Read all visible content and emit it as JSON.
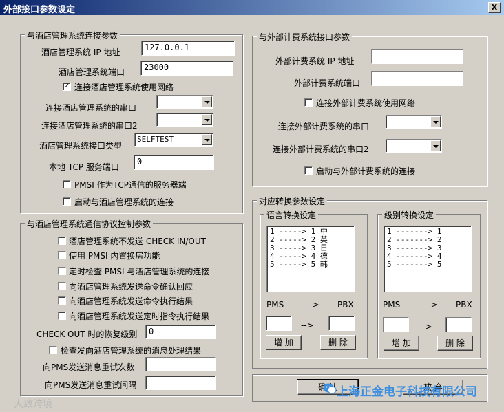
{
  "window": {
    "title": "外部接口参数设定",
    "close_label": "X"
  },
  "hotel": {
    "legend": "与酒店管理系统连接参数",
    "ip_label": "酒店管理系统 IP 地址",
    "ip_value": "127.0.0.1",
    "port_label": "酒店管理系统端口",
    "port_value": "23000",
    "use_network_label": "连接酒店管理系统使用网络",
    "use_network_checked": "✓",
    "serial_label": "连接酒店管理系统的串口",
    "serial_value": "",
    "serial2_label": "连接酒店管理系统的串口2",
    "serial2_value": "",
    "iface_type_label": "酒店管理系统接口类型",
    "iface_type_value": "SELFTEST",
    "tcp_port_label": "本地 TCP 服务端口",
    "tcp_port_value": "0",
    "pmsi_server_label": "PMSI 作为TCP通信的服务器端",
    "start_conn_label": "启动与酒店管理系统的连接"
  },
  "protocol": {
    "legend": "与酒店管理系统通信协议控制参数",
    "opt1": "酒店管理系统不发送 CHECK IN/OUT",
    "opt2": "使用 PMSI 内置换房功能",
    "opt3": "定时检查 PMSI 与酒店管理系统的连接",
    "opt4": "向酒店管理系统发送命令确认回应",
    "opt5": "向酒店管理系统发送命令执行结果",
    "opt6": "向酒店管理系统发送定时指令执行结果",
    "checkout_label": "CHECK OUT 时的恢复级别",
    "checkout_value": "0",
    "check_msg_label": "检查发向酒店管理系统的消息处理结果",
    "retry_count_label": "向PMS发送消息重试次数",
    "retry_count_value": "",
    "retry_interval_label": "向PMS发送消息重试间隔",
    "retry_interval_value": ""
  },
  "billing": {
    "legend": "与外部计费系统接口参数",
    "ip_label": "外部计费系统 IP 地址",
    "ip_value": "",
    "port_label": "外部计费系统端口",
    "port_value": "",
    "use_network_label": "连接外部计费系统使用网络",
    "serial_label": "连接外部计费系统的串口",
    "serial_value": "",
    "serial2_label": "连接外部计费系统的串口2",
    "serial2_value": "",
    "start_conn_label": "启动与外部计费系统的连接"
  },
  "mapping": {
    "legend": "对应转换参数设定",
    "language": {
      "legend": "语言转换设定",
      "items": [
        "1 -----> 1 中",
        "2 -----> 2 英",
        "3 -----> 3 日",
        "4 -----> 4 德",
        "5 -----> 5 韩"
      ],
      "pms_label": "PMS",
      "arrow_label": "----->",
      "pbx_label": "PBX",
      "mid_arrow": "-->",
      "add_label": "增 加",
      "delete_label": "删 除"
    },
    "level": {
      "legend": "级别转换设定",
      "items": [
        "1 -------> 1",
        "2 -------> 2",
        "3 -------> 3",
        "4 -------> 4",
        "5 -------> 5"
      ],
      "pms_label": "PMS",
      "arrow_label": "----->",
      "pbx_label": "PBX",
      "mid_arrow": "-->",
      "add_label": "增 加",
      "delete_label": "删 除"
    }
  },
  "footer": {
    "ok_label": "确  认",
    "cancel_label": "放  弃"
  },
  "watermarks": {
    "left": "大致跨境",
    "right": "上海正金电子科技有限公司"
  }
}
